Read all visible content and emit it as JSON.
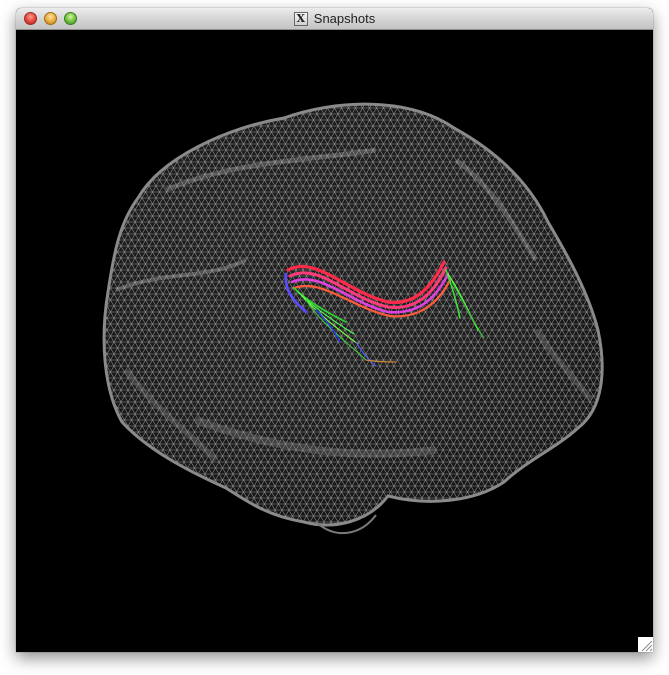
{
  "window": {
    "title": "Snapshots",
    "title_icon_glyph": "X",
    "title_icon": "x11-icon",
    "buttons": [
      "close-button",
      "minimize-button",
      "zoom-button"
    ]
  },
  "viewport": {
    "background": "#000000",
    "mesh_color": "#a6a6a6",
    "mesh": "brain-wireframe-mesh",
    "tract": "fiber-tract-bundle"
  }
}
